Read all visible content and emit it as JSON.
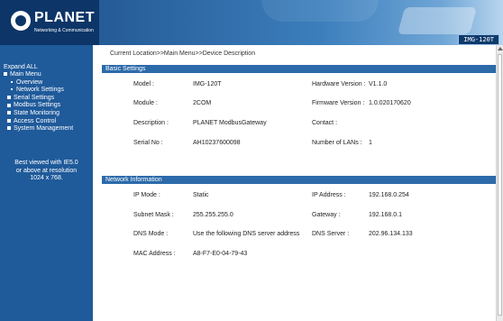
{
  "brand": {
    "name": "PLANET",
    "tagline": "Networking & Communication",
    "model_badge": "IMG-120T"
  },
  "sidebar": {
    "expand_all": "Expand ALL",
    "menu_title": "Main Menu",
    "items": [
      {
        "label": "Overview",
        "type": "sub"
      },
      {
        "label": "Network Settings",
        "type": "sub"
      },
      {
        "label": "Serial Settings",
        "type": "folder"
      },
      {
        "label": "Modbus Settings",
        "type": "folder"
      },
      {
        "label": "State Monitoring",
        "type": "folder"
      },
      {
        "label": "Access Control",
        "type": "folder"
      },
      {
        "label": "System Management",
        "type": "folder"
      }
    ],
    "tip": [
      "Best viewed with IE5.0",
      "or above at resolution",
      "1024 x 768."
    ]
  },
  "main": {
    "location": "Current Location>>Main Menu>>Device Description",
    "basic": {
      "title": "Basic Settings",
      "model_label": "Model :",
      "model_value": "IMG-120T",
      "hw_label": "Hardware Version :",
      "hw_value": "V1.1.0",
      "module_label": "Module :",
      "module_value": "2COM",
      "fw_label": "Firmware Version :",
      "fw_value": "1.0.020170620",
      "desc_label": "Description :",
      "desc_value": "PLANET ModbusGateway",
      "contact_label": "Contact :",
      "contact_value": "",
      "serial_label": "Serial No :",
      "serial_value": "AH10237600098",
      "lans_label": "Number of LANs :",
      "lans_value": "1"
    },
    "network": {
      "title": "Network Information",
      "ipmode_label": "IP Mode :",
      "ipmode_value": "Static",
      "ip_label": "IP Address :",
      "ip_value": "192.168.0.254",
      "mask_label": "Subnet Mask :",
      "mask_value": "255.255.255.0",
      "gw_label": "Gateway :",
      "gw_value": "192.168.0.1",
      "dnsmode_label": "DNS Mode :",
      "dnsmode_value": "Use the following DNS server address",
      "dns_label": "DNS Server :",
      "dns_value": "202.96.134.133",
      "mac_label": "MAC Address :",
      "mac_value": "A8-F7-E0-04-79-43"
    }
  }
}
